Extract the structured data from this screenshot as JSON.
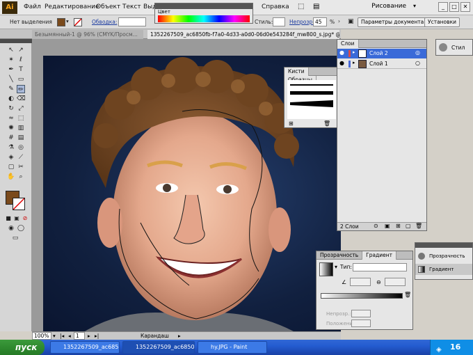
{
  "menubar": {
    "logo": "Ai",
    "items": [
      "Файл",
      "Редактирование",
      "Объект",
      "Текст",
      "Выд",
      "Справка"
    ],
    "workspace": "Рисование",
    "window_buttons": [
      "_",
      "□",
      "✕"
    ]
  },
  "control_bar": {
    "selection": "Нет выделения",
    "stroke_label": "Обводка:",
    "style_label": "Стиль:",
    "opacity_label": "Непрозр.:",
    "opacity_value": "45",
    "opacity_unit": "%",
    "doc_params_button": "Параметры документа",
    "settings_button": "Установки",
    "fill_color": "#7a4a1c"
  },
  "doc_tabs": [
    "Безымянный-1 @ 96% (CMYK/Просм...",
    "1352267509_ac6850fb-f7a0-4d33-a0d0-06d0e543284f_mw800_s.jpg* @ 100% (RGB/Просмотр)"
  ],
  "color_panel": {
    "title": "Цвет"
  },
  "brushes_panel": {
    "tabs": [
      "Кисти",
      "Образцы"
    ]
  },
  "layers_panel": {
    "tab": "Слои",
    "layers": [
      {
        "name": "Слой 2",
        "selected": true,
        "color": "#d94a4a"
      },
      {
        "name": "Слой 1",
        "selected": false,
        "color": "#4a6ad9"
      }
    ],
    "footer": "2 Слои"
  },
  "gradient_panel": {
    "tabs": [
      "Прозрачность",
      "Градиент"
    ],
    "type_label": "Тип:",
    "angle_label": "∠",
    "opacity_label": "Непрозр.:",
    "location_label": "Положение:"
  },
  "mini_panels": {
    "style_label": "Стил",
    "transparency_label": "Прозрачность",
    "gradient_label": "Градиент"
  },
  "status_bar": {
    "zoom": "100%",
    "page": "1",
    "tool": "Карандаш"
  },
  "taskbar": {
    "start": "пуск",
    "tasks": [
      "1352267509_ac6850...",
      "1352267509_ac6850...",
      "hy.JPG - Paint"
    ],
    "clock": "16"
  }
}
